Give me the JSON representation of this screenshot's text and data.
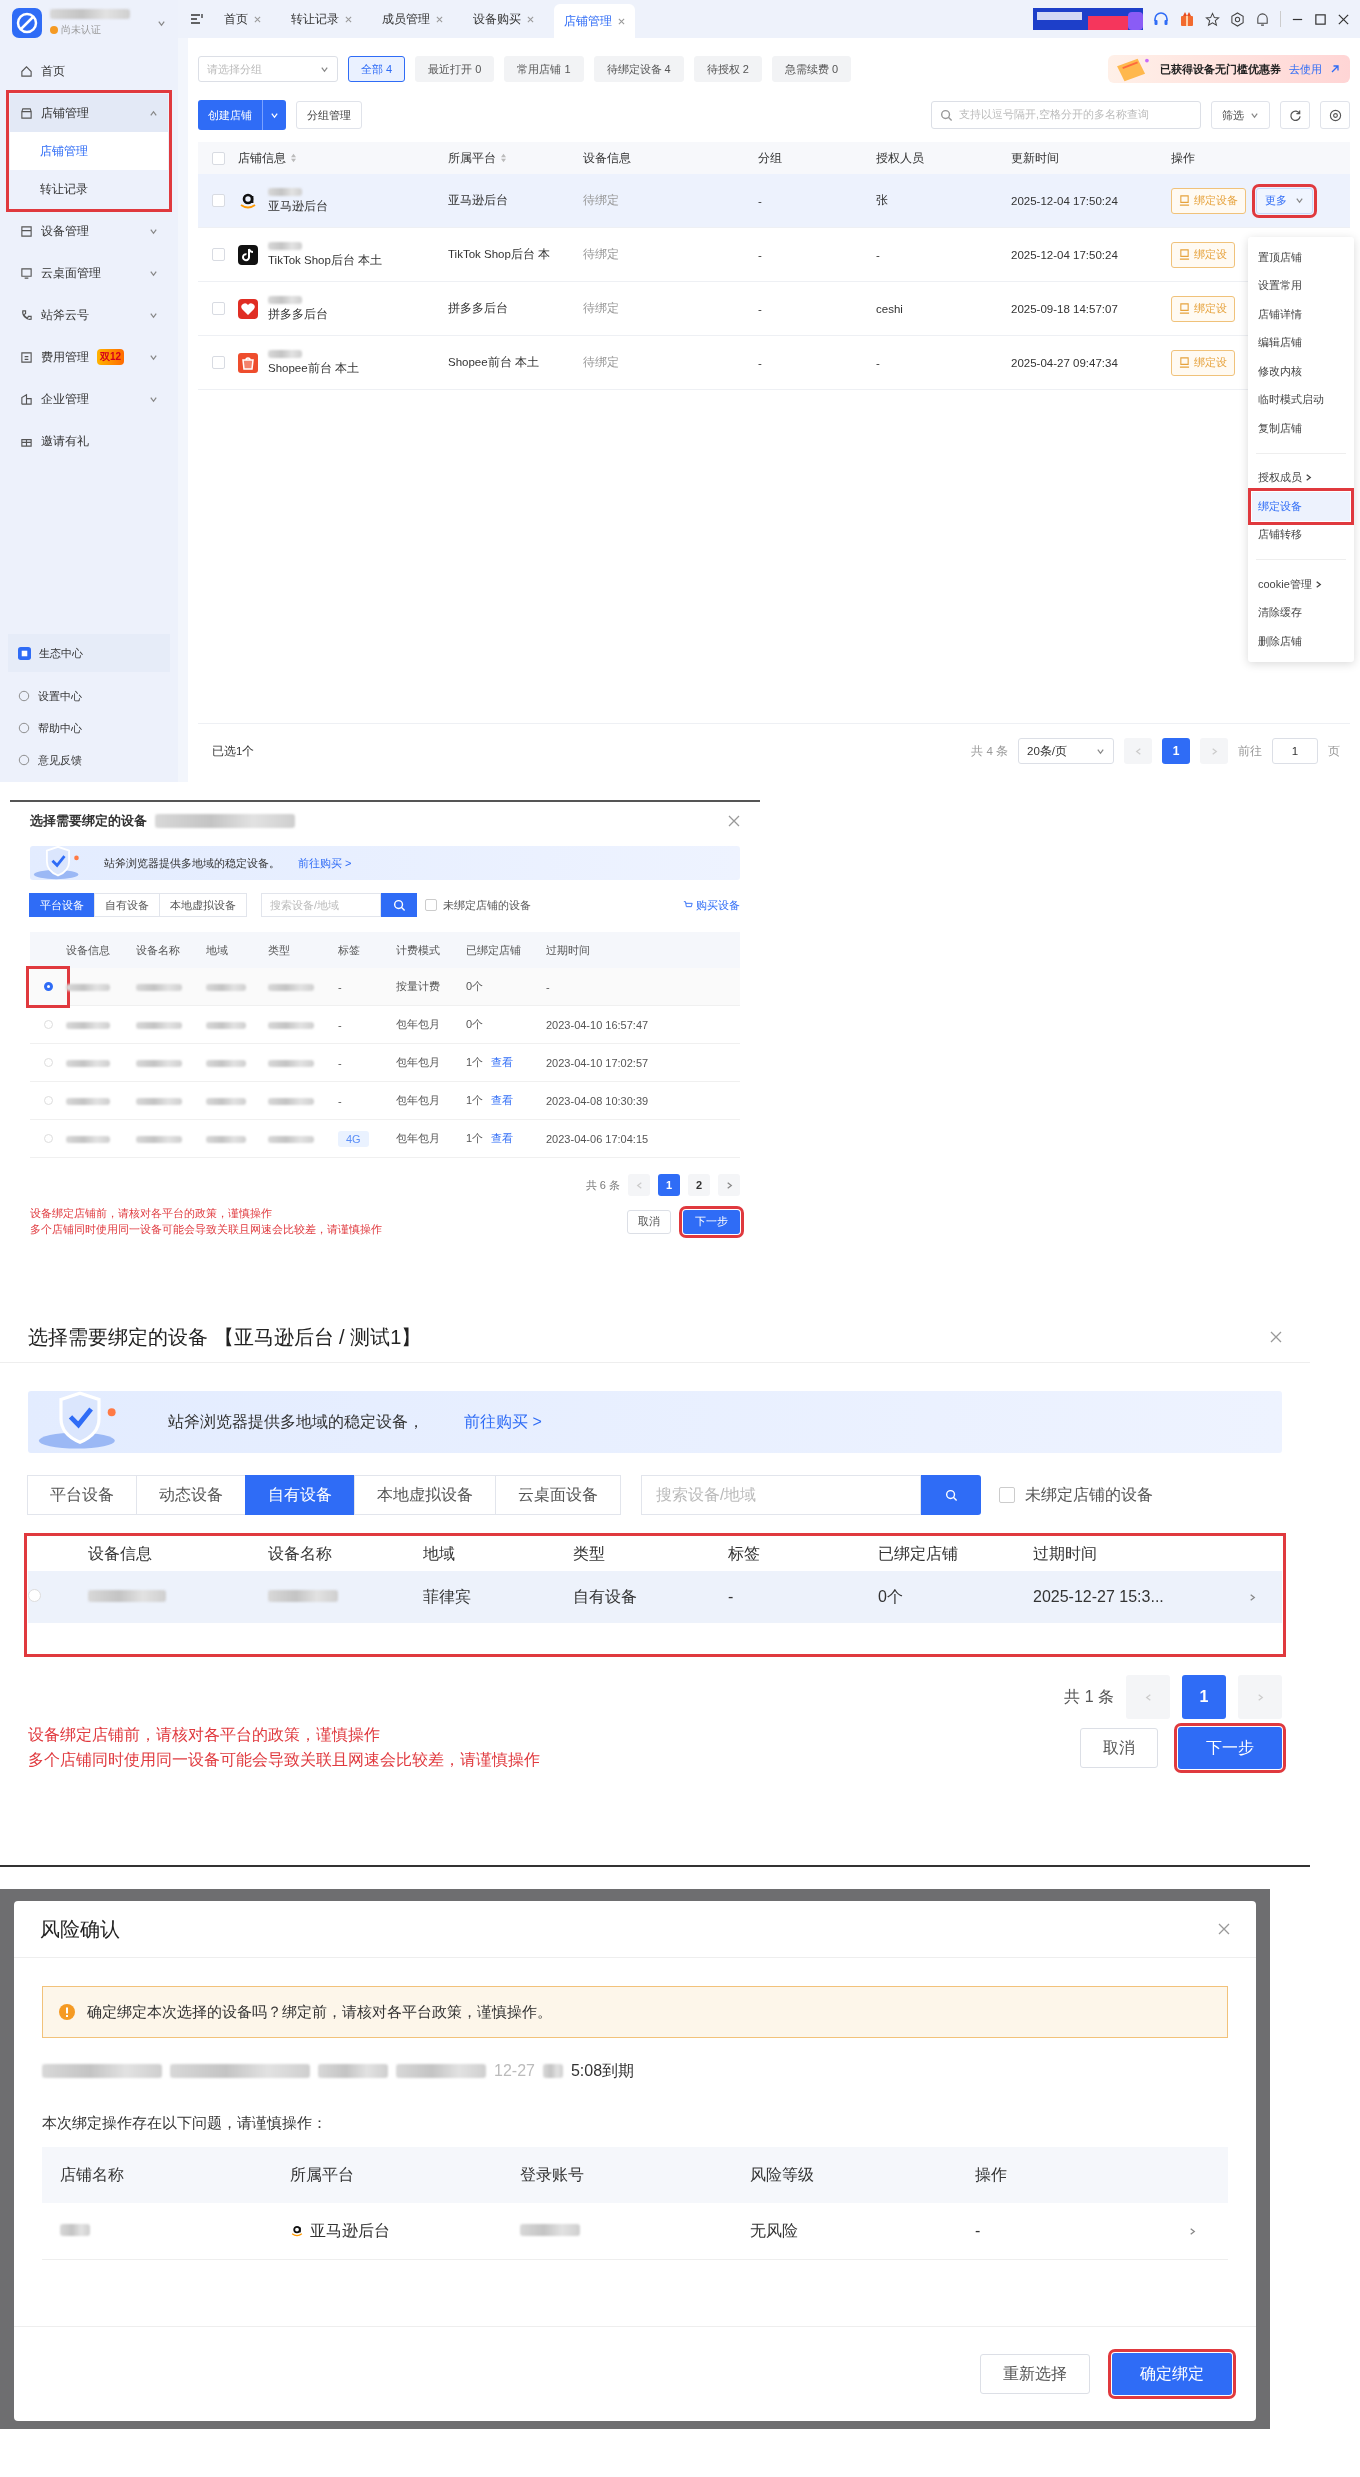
{
  "main_window": {
    "account": {
      "status": "尚未认证"
    },
    "tabs": [
      {
        "label": "首页",
        "selected": false
      },
      {
        "label": "转让记录",
        "selected": false
      },
      {
        "label": "成员管理",
        "selected": false
      },
      {
        "label": "设备购买",
        "selected": false
      },
      {
        "label": "店铺管理",
        "selected": true
      }
    ],
    "sidebar": {
      "items": [
        {
          "kind": "link",
          "label": "首页"
        },
        {
          "kind": "group",
          "label": "店铺管理",
          "expanded": true,
          "highlighted": true,
          "children": [
            {
              "label": "店铺管理",
              "selected": true
            },
            {
              "label": "转让记录",
              "selected": false
            }
          ]
        },
        {
          "kind": "group",
          "label": "设备管理",
          "expanded": false
        },
        {
          "kind": "group",
          "label": "云桌面管理",
          "expanded": false
        },
        {
          "kind": "group",
          "label": "站斧云号",
          "expanded": false
        },
        {
          "kind": "group",
          "label": "费用管理",
          "expanded": false,
          "badge": "双12"
        },
        {
          "kind": "group",
          "label": "企业管理",
          "expanded": false
        },
        {
          "kind": "link",
          "label": "邀请有礼"
        }
      ],
      "bottom_items": [
        {
          "label": "生态中心"
        },
        {
          "label": "设置中心"
        },
        {
          "label": "帮助中心"
        },
        {
          "label": "意见反馈"
        }
      ]
    },
    "filters": {
      "group_select": {
        "placeholder": "请选择分组"
      },
      "chips": [
        {
          "label": "全部 4",
          "selected": true
        },
        {
          "label": "最近打开 0",
          "selected": false
        },
        {
          "label": "常用店铺 1",
          "selected": false
        },
        {
          "label": "待绑定设备 4",
          "selected": false
        },
        {
          "label": "待授权 2",
          "selected": false
        },
        {
          "label": "急需续费 0",
          "selected": false
        }
      ]
    },
    "coupon": {
      "text": "已获得设备无门槛优惠券",
      "link": "去使用"
    },
    "toolbar": {
      "create_button": "创建店铺",
      "group_button": "分组管理",
      "search": {
        "placeholder": "支持以逗号隔开,空格分开的多名称查询"
      },
      "filter_button": "筛选"
    },
    "table": {
      "all_checked": false,
      "columns": [
        {
          "label": "店铺信息",
          "sortable": true
        },
        {
          "label": "所属平台",
          "sortable": true
        },
        {
          "label": "设备信息",
          "sortable": false
        },
        {
          "label": "分组",
          "sortable": false
        },
        {
          "label": "授权人员",
          "sortable": false
        },
        {
          "label": "更新时间",
          "sortable": false
        },
        {
          "label": "操作",
          "sortable": false
        }
      ],
      "rows": [
        {
          "kind": "amazon",
          "selected": true,
          "checked": false,
          "platform_line": "亚马逊后台",
          "platform": "亚马逊后台",
          "device": "待绑定",
          "group": "-",
          "member": "张",
          "updated": "2025-12-04 17:50:24",
          "bind_button": "绑定设备",
          "more_button": "更多",
          "more_highlighted": true
        },
        {
          "kind": "tiktok",
          "selected": false,
          "checked": false,
          "platform_line": "TikTok Shop后台 本土",
          "platform": "TikTok Shop后台 本",
          "device": "待绑定",
          "group": "-",
          "member": "-",
          "updated": "2025-12-04 17:50:24",
          "bind_button": "绑定设"
        },
        {
          "kind": "pinduoduo",
          "selected": false,
          "checked": false,
          "platform_line": "拼多多后台",
          "platform": "拼多多后台",
          "device": "待绑定",
          "group": "-",
          "member": "ceshi",
          "updated": "2025-09-18 14:57:07",
          "bind_button": "绑定设"
        },
        {
          "kind": "shopee",
          "selected": false,
          "checked": false,
          "platform_line": "Shopee前台 本土",
          "platform": "Shopee前台 本土",
          "device": "待绑定",
          "group": "-",
          "member": "-",
          "updated": "2025-04-27 09:47:34",
          "bind_button": "绑定设"
        }
      ]
    },
    "more_menu": {
      "groups": [
        [
          {
            "label": "置顶店铺",
            "submenu": false,
            "highlighted": false
          },
          {
            "label": "设置常用",
            "submenu": false,
            "highlighted": false
          },
          {
            "label": "店铺详情",
            "submenu": false,
            "highlighted": false
          },
          {
            "label": "编辑店铺",
            "submenu": false,
            "highlighted": false
          },
          {
            "label": "修改内核",
            "submenu": false,
            "highlighted": false
          },
          {
            "label": "临时模式启动",
            "submenu": false,
            "highlighted": false
          },
          {
            "label": "复制店铺",
            "submenu": false,
            "highlighted": false
          }
        ],
        [
          {
            "label": "授权成员",
            "submenu": true,
            "highlighted": false
          },
          {
            "label": "绑定设备",
            "submenu": false,
            "highlighted": true
          },
          {
            "label": "店铺转移",
            "submenu": false,
            "highlighted": false
          }
        ],
        [
          {
            "label": "cookie管理",
            "submenu": true,
            "highlighted": false
          },
          {
            "label": "清除缓存",
            "submenu": false,
            "highlighted": false
          },
          {
            "label": "删除店铺",
            "submenu": false,
            "highlighted": false
          }
        ]
      ]
    },
    "footer": {
      "selected_count": "已选1个",
      "total": "共 4 条",
      "page_size": "20条/页",
      "pages": [
        {
          "label": "1",
          "selected": true
        }
      ],
      "goto_label": "前往",
      "goto_value": "1",
      "goto_suffix": "页"
    }
  },
  "bind_dialog_preview": {
    "title": "选择需要绑定的设备",
    "banner_text": "站斧浏览器提供多地域的稳定设备。",
    "banner_link": "前往购买 >",
    "tabs": [
      {
        "label": "平台设备",
        "selected": true
      },
      {
        "label": "自有设备",
        "selected": false
      },
      {
        "label": "本地虚拟设备",
        "selected": false
      }
    ],
    "search": {
      "placeholder": "搜索设备/地域"
    },
    "filter_checkbox": {
      "label": "未绑定店铺的设备",
      "checked": false
    },
    "buy_link": "购买设备",
    "columns": [
      "设备信息",
      "设备名称",
      "地域",
      "类型",
      "标签",
      "计费模式",
      "已绑定店铺",
      "过期时间"
    ],
    "rows": [
      {
        "selected": true,
        "highlighted": true,
        "tag": "-",
        "billing": "按量计费",
        "bound": "0个",
        "expires": "-"
      },
      {
        "selected": false,
        "highlighted": false,
        "tag": "-",
        "billing": "包年包月",
        "bound": "0个",
        "expires": "2023-04-10 16:57:47"
      },
      {
        "selected": false,
        "highlighted": false,
        "tag": "-",
        "billing": "包年包月",
        "bound": "1个",
        "view_link": "查看",
        "expires": "2023-04-10 17:02:57"
      },
      {
        "selected": false,
        "highlighted": false,
        "tag": "-",
        "billing": "包年包月",
        "bound": "1个",
        "view_link": "查看",
        "expires": "2023-04-08 10:30:39"
      },
      {
        "selected": false,
        "highlighted": false,
        "tag_chip": "4G",
        "billing": "包年包月",
        "bound": "1个",
        "view_link": "查看",
        "expires": "2023-04-06 17:04:15"
      }
    ],
    "total": "共 6 条",
    "pages": [
      {
        "label": "1",
        "selected": true
      },
      {
        "label": "2",
        "selected": false
      }
    ],
    "warnings": [
      "设备绑定店铺前，请核对各平台的政策，谨慎操作",
      "多个店铺同时使用同一设备可能会导致关联且网速会比较差，请谨慎操作"
    ],
    "cancel_button": "取消",
    "next_button": "下一步",
    "next_highlighted": true
  },
  "bind_dialog": {
    "title": "选择需要绑定的设备 【亚马逊后台 / 测试1】",
    "banner_text": "站斧浏览器提供多地域的稳定设备，",
    "banner_link": "前往购买 >",
    "tabs": [
      {
        "label": "平台设备",
        "selected": false
      },
      {
        "label": "动态设备",
        "selected": false
      },
      {
        "label": "自有设备",
        "selected": true
      },
      {
        "label": "本地虚拟设备",
        "selected": false
      },
      {
        "label": "云桌面设备",
        "selected": false
      }
    ],
    "search": {
      "placeholder": "搜索设备/地域"
    },
    "filter_checkbox": {
      "label": "未绑定店铺的设备",
      "checked": false
    },
    "columns": [
      "设备信息",
      "设备名称",
      "地域",
      "类型",
      "标签",
      "已绑定店铺",
      "过期时间"
    ],
    "table_highlighted": true,
    "rows": [
      {
        "selected": false,
        "region": "菲律宾",
        "type": "自有设备",
        "tag": "-",
        "bound": "0个",
        "expires": "2025-12-27 15:3..."
      }
    ],
    "total": "共 1 条",
    "pages": [
      {
        "label": "1",
        "selected": true
      }
    ],
    "warnings": [
      "设备绑定店铺前，请核对各平台的政策，谨慎操作",
      "多个店铺同时使用同一设备可能会导致关联且网速会比较差，请谨慎操作"
    ],
    "cancel_button": "取消",
    "next_button": "下一步",
    "next_highlighted": true
  },
  "risk_dialog": {
    "title": "风险确认",
    "alert": "确定绑定本次选择的设备吗？绑定前，请核对各平台政策，谨慎操作。",
    "device_line_parts": [
      "12-27",
      "5:08到期"
    ],
    "note": "本次绑定操作存在以下问题，请谨慎操作：",
    "columns": [
      "店铺名称",
      "所属平台",
      "登录账号",
      "风险等级",
      "操作"
    ],
    "rows": [
      {
        "kind": "amazon",
        "platform": "亚马逊后台",
        "risk": "无风险",
        "action": "-"
      }
    ],
    "reselect_button": "重新选择",
    "confirm_button": "确定绑定",
    "confirm_highlighted": true
  }
}
